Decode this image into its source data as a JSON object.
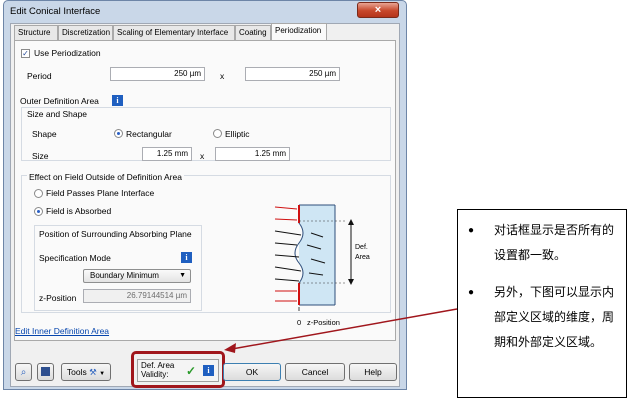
{
  "window": {
    "title": "Edit Conical Interface",
    "close_glyph": "×"
  },
  "tabs": [
    {
      "label": "Structure"
    },
    {
      "label": "Discretization"
    },
    {
      "label": "Scaling of Elementary Interface"
    },
    {
      "label": "Coating"
    },
    {
      "label": "Periodization"
    }
  ],
  "periodization": {
    "use_label": "Use Periodization",
    "use_checked": true,
    "period_label": "Period",
    "period_x": "250 µm",
    "period_sep": "x",
    "period_y": "250 µm"
  },
  "outer": {
    "title": "Outer Definition Area",
    "size_shape_title": "Size and Shape",
    "shape_label": "Shape",
    "shape_options": [
      "Rectangular",
      "Elliptic"
    ],
    "shape_selected": "Rectangular",
    "size_label": "Size",
    "size_x": "1.25 mm",
    "size_sep": "x",
    "size_y": "1.25 mm"
  },
  "effect": {
    "title": "Effect on Field Outside of Definition Area",
    "options": [
      "Field Passes Plane Interface",
      "Field is Absorbed"
    ],
    "selected": "Field is Absorbed",
    "absorb_title": "Position of Surrounding Absorbing Plane",
    "spec_mode_label": "Specification Mode",
    "spec_mode_value": "Boundary Minimum",
    "z_label": "z-Position",
    "z_value": "26.79144514 µm"
  },
  "diagram": {
    "def_label_1": "Def.",
    "def_label_2": "Area",
    "origin_label": "0",
    "axis_label": "z-Position"
  },
  "links": {
    "edit_inner": "Edit Inner Definition Area"
  },
  "toolbar": {
    "tools_label": "Tools",
    "validity_label_1": "Def. Area",
    "validity_label_2": "Validity:",
    "validity_mark": "✓",
    "ok_label": "OK",
    "cancel_label": "Cancel",
    "help_label": "Help"
  },
  "icons": {
    "info": "i",
    "info_color": "#1f5fc0",
    "highlight_color": "#a0161c"
  },
  "callout": {
    "bullets": [
      "对话框显示是否所有的设置都一致。",
      "另外，下图可以显示内部定义区域的维度，周期和外部定义区域。"
    ]
  }
}
